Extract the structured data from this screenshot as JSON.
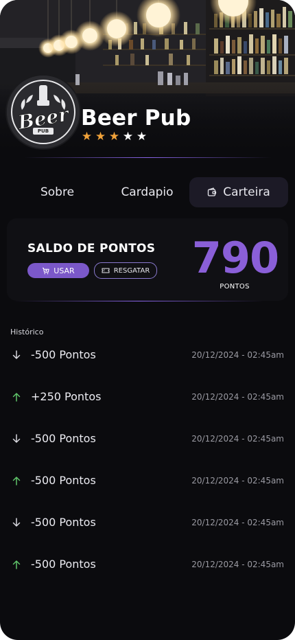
{
  "pub": {
    "name": "Beer Pub",
    "logo_text": "Beer",
    "logo_sub": "PUB",
    "rating": 3,
    "rating_max": 5,
    "star_on_color": "#f0a23a",
    "star_off_color": "#ffffff"
  },
  "tabs": [
    {
      "label": "Sobre",
      "active": false
    },
    {
      "label": "Cardapio",
      "active": false
    },
    {
      "label": "Carteira",
      "active": true,
      "icon": "wallet-icon"
    }
  ],
  "wallet": {
    "title": "SALDO DE PONTOS",
    "use_label": "USAR",
    "use_icon": "cart-icon",
    "redeem_label": "RESGATAR",
    "redeem_icon": "ticket-icon",
    "points": "790",
    "points_unit": "PONTOS",
    "accent_color": "#8a5fd8"
  },
  "history": {
    "title": "Histórico",
    "items": [
      {
        "direction": "down",
        "icon": "arrow-down-icon",
        "amount": "-500 Pontos",
        "date": "20/12/2024 - 02:45am"
      },
      {
        "direction": "up",
        "icon": "arrow-up-icon",
        "amount": "+250 Pontos",
        "date": "20/12/2024 - 02:45am"
      },
      {
        "direction": "down",
        "icon": "arrow-down-icon",
        "amount": "-500 Pontos",
        "date": "20/12/2024 - 02:45am"
      },
      {
        "direction": "up",
        "icon": "arrow-up-icon",
        "amount": "-500 Pontos",
        "date": "20/12/2024 - 02:45am"
      },
      {
        "direction": "down",
        "icon": "arrow-down-icon",
        "amount": "-500 Pontos",
        "date": "20/12/2024 - 02:45am"
      },
      {
        "direction": "up",
        "icon": "arrow-up-icon",
        "amount": "-500 Pontos",
        "date": "20/12/2024 - 02:45am"
      }
    ],
    "up_color": "#5fc46a",
    "down_color": "#d8d8de"
  }
}
